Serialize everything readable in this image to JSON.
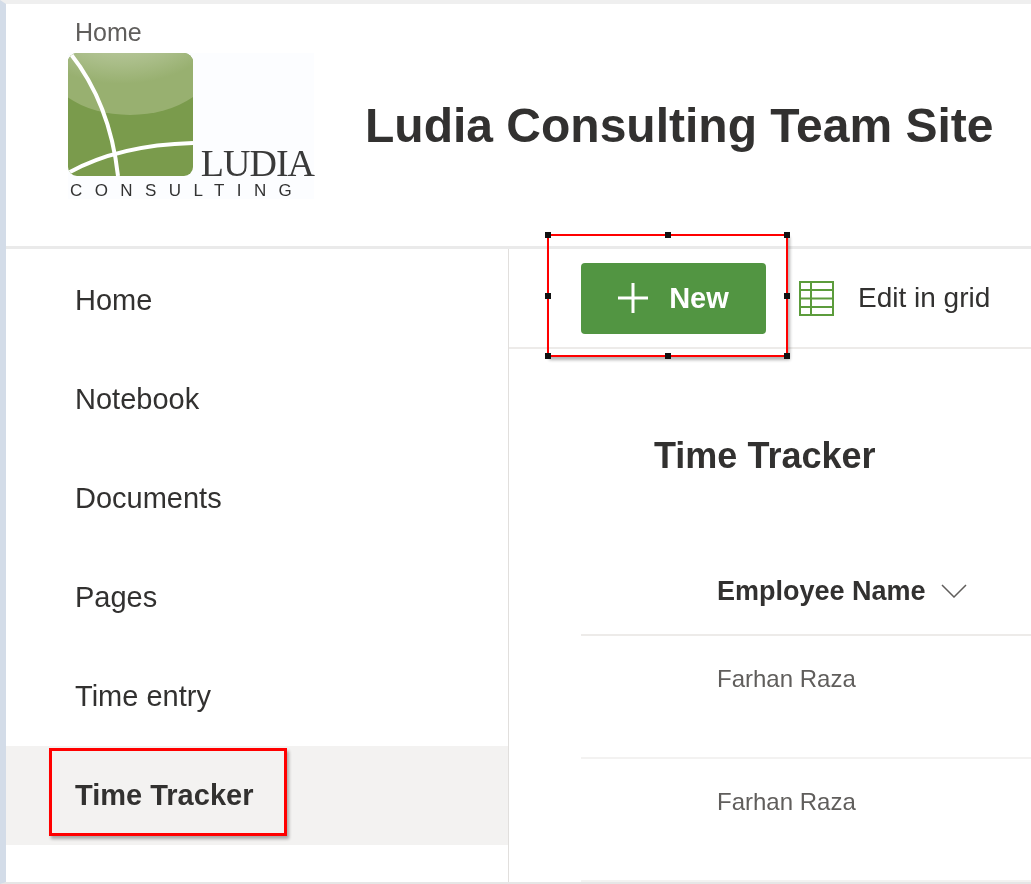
{
  "breadcrumb": {
    "label": "Home"
  },
  "logo": {
    "wordmark": "LUDIA",
    "tagline": "CONSULTING"
  },
  "site_title": "Ludia Consulting Team Site",
  "nav": {
    "items": [
      {
        "label": "Home",
        "selected": false,
        "highlighted": false
      },
      {
        "label": "Notebook",
        "selected": false,
        "highlighted": false
      },
      {
        "label": "Documents",
        "selected": false,
        "highlighted": false
      },
      {
        "label": "Pages",
        "selected": false,
        "highlighted": false
      },
      {
        "label": "Time entry",
        "selected": false,
        "highlighted": false
      },
      {
        "label": "Time Tracker",
        "selected": true,
        "highlighted": true
      }
    ]
  },
  "command_bar": {
    "new_button": {
      "label": "New",
      "highlighted": true
    },
    "edit_grid_button": {
      "label": "Edit in grid"
    }
  },
  "list": {
    "title": "Time Tracker",
    "columns": [
      {
        "label": "Employee Name"
      }
    ],
    "rows": [
      {
        "cells": [
          "Farhan Raza"
        ]
      },
      {
        "cells": [
          "Farhan Raza"
        ]
      }
    ]
  }
}
